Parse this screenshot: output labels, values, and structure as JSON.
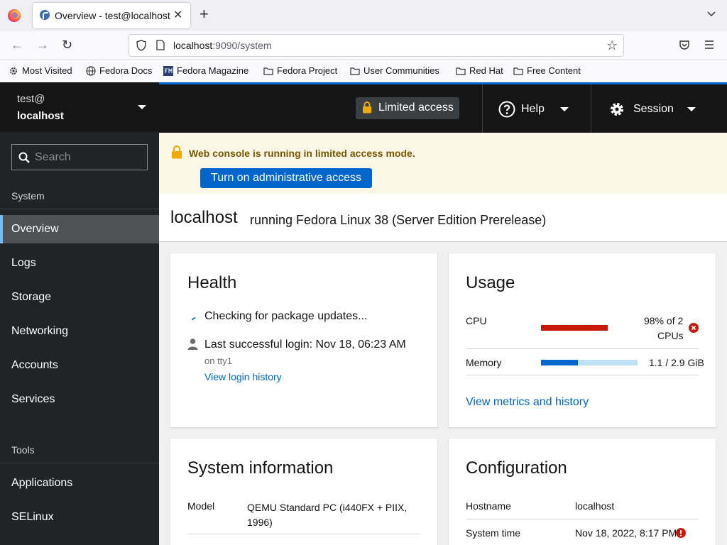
{
  "browser": {
    "tab_title": "Overview - test@localhost",
    "url_host": "localhost",
    "url_rest": ":9090/system",
    "bookmarks": [
      "Most Visited",
      "Fedora Docs",
      "Fedora Magazine",
      "Fedora Project",
      "User Communities",
      "Red Hat",
      "Free Content"
    ]
  },
  "sidebar": {
    "host_user": "test@",
    "host_name": "localhost",
    "search_placeholder": "Search",
    "system_label": "System",
    "system_items": [
      "Overview",
      "Logs",
      "Storage",
      "Networking",
      "Accounts",
      "Services"
    ],
    "active_item": "Overview",
    "tools_label": "Tools",
    "tools_items": [
      "Applications",
      "SELinux"
    ]
  },
  "masthead": {
    "limited_access": "Limited access",
    "help": "Help",
    "session": "Session"
  },
  "alert": {
    "title": "Web console is running in limited access mode.",
    "button": "Turn on administrative access"
  },
  "header": {
    "hostname": "localhost",
    "os": "running Fedora Linux 38 (Server Edition Prerelease)"
  },
  "health": {
    "title": "Health",
    "updates": "Checking for package updates...",
    "login": "Last successful login: Nov 18, 06:23 AM",
    "login_tty": "on tty1",
    "login_link": "View login history"
  },
  "usage": {
    "title": "Usage",
    "cpu_label": "CPU",
    "cpu_value_line1": "98% of 2",
    "cpu_value_line2": "CPUs",
    "cpu_fraction": 0.98,
    "memory_label": "Memory",
    "memory_value": "1.1 / 2.9 GiB",
    "memory_fraction": 0.38,
    "metrics_link": "View metrics and history"
  },
  "sysinfo": {
    "title": "System information",
    "model_label": "Model",
    "model_value": "QEMU Standard PC (i440FX + PIIX, 1996)"
  },
  "config": {
    "title": "Configuration",
    "hostname_label": "Hostname",
    "hostname_value": "localhost",
    "time_label": "System time",
    "time_value": "Nov 18, 2022, 8:17 PM"
  },
  "colors": {
    "accent": "#0066cc",
    "danger": "#c9190b",
    "warning": "#f0ab00"
  }
}
